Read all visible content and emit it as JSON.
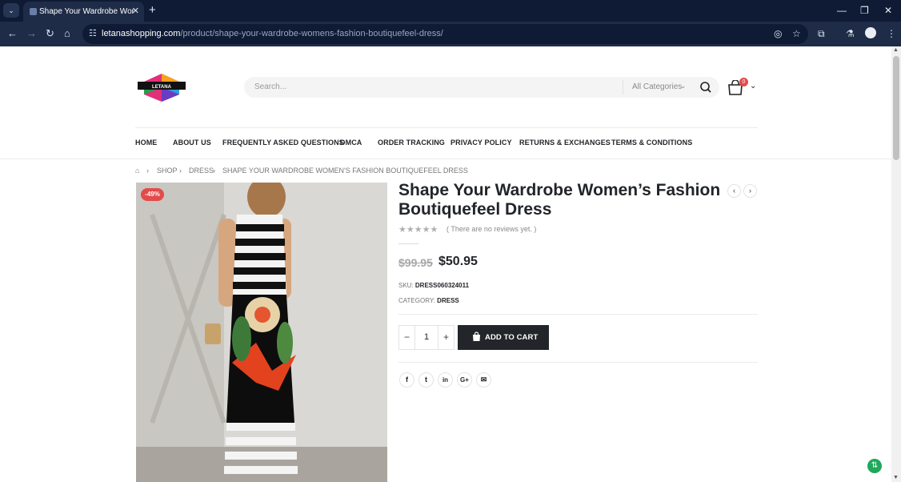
{
  "browser": {
    "tab_title": "Shape Your Wardrobe Women's Fashion Boutiquefeel Dress",
    "tab_close": "✕",
    "new_tab": "+",
    "url_host": "letanashopping.com",
    "url_path": "/product/shape-your-wardrobe-womens-fashion-boutiquefeel-dress/"
  },
  "header": {
    "logo_text": "LETANA",
    "search_placeholder": "Search...",
    "category_select": "All Categories",
    "cart_count": "0"
  },
  "nav": {
    "items": [
      "HOME",
      "ABOUT US",
      "FREQUENTLY ASKED QUESTIONS",
      "DMCA",
      "ORDER TRACKING",
      "PRIVACY POLICY",
      "RETURNS & EXCHANGES",
      "TERMS & CONDITIONS"
    ]
  },
  "breadcrumb": {
    "shop": "SHOP",
    "category": "DRESS",
    "current": "SHAPE YOUR WARDROBE WOMEN'S FASHION BOUTIQUEFEEL DRESS"
  },
  "product": {
    "badge": "-49%",
    "title": "Shape Your Wardrobe Women’s Fashion Boutiquefeel Dress",
    "rating_stars": "★★★★★",
    "reviews_text": "( There are no reviews yet. )",
    "old_price": "$99.95",
    "new_price": "$50.95",
    "sku_label": "SKU:",
    "sku_value": "DRESS060324011",
    "category_label": "CATEGORY:",
    "category_value": "DRESS",
    "quantity": "1",
    "add_to_cart": "ADD TO CART"
  },
  "share": [
    "f",
    "t",
    "in",
    "G+",
    "✉"
  ],
  "colors": {
    "accent": "#222529",
    "sale": "#e34b4b",
    "chrome_dark": "#0f1b35",
    "chrome_bar": "#1f2c48"
  }
}
